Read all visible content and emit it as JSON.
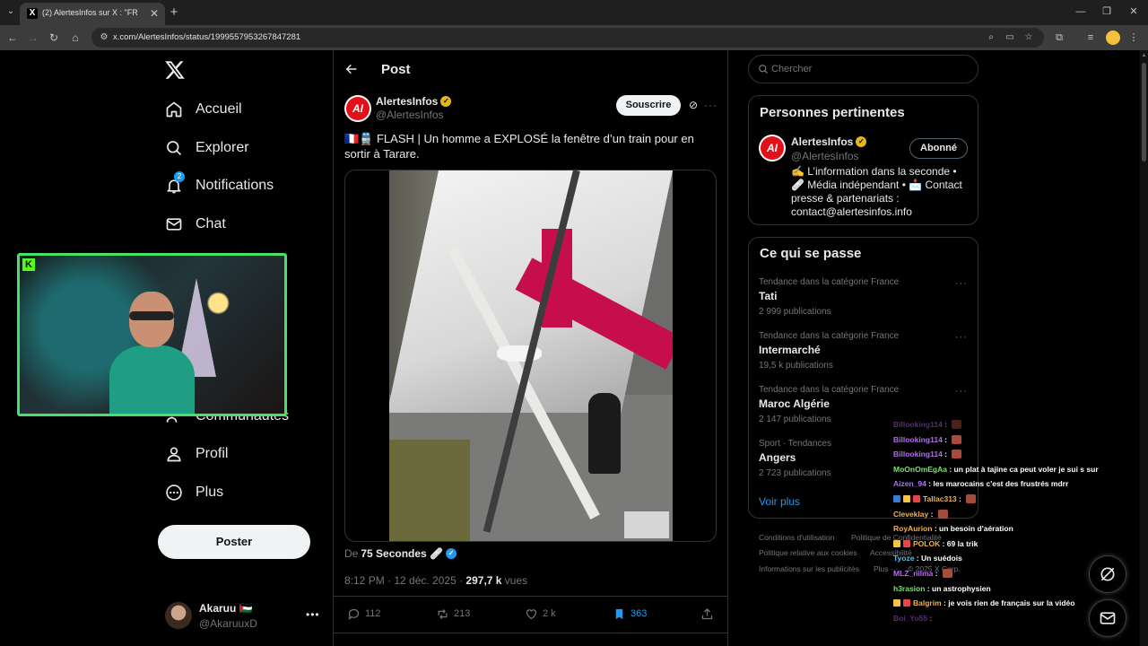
{
  "browser": {
    "tab_title": "(2) AlertesInfos sur X : \"FR",
    "tab_favicon": "X",
    "url": "x.com/AlertesInfos/status/1999557953267847281"
  },
  "nav": {
    "items": [
      {
        "label": "Accueil",
        "icon": "home-icon"
      },
      {
        "label": "Explorer",
        "icon": "search-icon"
      },
      {
        "label": "Notifications",
        "icon": "bell-icon",
        "badge": "2"
      },
      {
        "label": "Chat",
        "icon": "mail-icon"
      },
      {
        "label": "Communautés",
        "icon": "people-icon"
      },
      {
        "label": "Profil",
        "icon": "person-icon"
      },
      {
        "label": "Plus",
        "icon": "more-circle-icon"
      }
    ],
    "post_button": "Poster",
    "user": {
      "name": "Akaruu 🇵🇸",
      "handle": "@AkaruuxD"
    }
  },
  "post": {
    "header_title": "Post",
    "author_name": "AlertesInfos",
    "author_handle": "@AlertesInfos",
    "avatar_text": "AI",
    "subscribe_label": "Souscrire",
    "text": "🇫🇷🚆 FLASH | Un homme a EXPLOSÉ la fenêtre d’un train pour en sortir à Tarare.",
    "from_prefix": "De",
    "from_source": "75 Secondes 🩹",
    "time": "8:12 PM · 12 déc. 2025 · ",
    "views_count": "297,7 k",
    "views_label": " vues",
    "stats": {
      "replies": "112",
      "reposts": "213",
      "likes": "2 k",
      "bookmarks": "363"
    }
  },
  "sidebar": {
    "search_placeholder": "Chercher",
    "relevant": {
      "title": "Personnes pertinentes",
      "name": "AlertesInfos",
      "handle": "@AlertesInfos",
      "follow_label": "Abonné",
      "bio": "✍️ L’information dans la seconde • 🩹 Média indépendant • 📩 Contact presse & partenariats : contact@alertesinfos.info"
    },
    "trends_title": "Ce qui se passe",
    "trends": [
      {
        "category": "Tendance dans la catégorie France",
        "name": "Tati",
        "count": "2 999 publications"
      },
      {
        "category": "Tendance dans la catégorie France",
        "name": "Intermarché",
        "count": "19,5 k publications"
      },
      {
        "category": "Tendance dans la catégorie France",
        "name": "Maroc Algérie",
        "count": "2 147 publications"
      },
      {
        "category": "Sport · Tendances",
        "name": "Angers",
        "count": "2 723 publications"
      }
    ],
    "see_more": "Voir plus",
    "footer": [
      "Conditions d'utilisation",
      "Politique de Confidentialité",
      "Politique relative aux cookies",
      "Accessibilité",
      "Informations sur les publicités",
      "Plus ···",
      "© 2025 X Corp."
    ]
  },
  "chat": [
    {
      "user": "Billooking114",
      "msg": "",
      "color": "#b86bf0",
      "emote": true
    },
    {
      "user": "Billooking114",
      "msg": "",
      "color": "#b86bf0",
      "emote": true
    },
    {
      "user": "Billooking114",
      "msg": "",
      "color": "#b86bf0",
      "emote": true
    },
    {
      "user": "MoOnOmEgAa",
      "msg": "un plat à tajine ca peut voler je sui s sur",
      "color": "#7be36e",
      "emote": false
    },
    {
      "user": "Aizen_94",
      "msg": "les marocains c'est des frustrés mdrr",
      "color": "#b86bf0",
      "emote": false
    },
    {
      "user": "Tallac313",
      "msg": "",
      "color": "#f0b24a",
      "emote": true,
      "badges": [
        "#3a7bd5",
        "#f5c542",
        "#e94545"
      ]
    },
    {
      "user": "Cleveklay",
      "msg": "",
      "color": "#f0b24a",
      "emote": true
    },
    {
      "user": "RoyAurion",
      "msg": "un besoin d'aération",
      "color": "#f0b24a",
      "emote": false
    },
    {
      "user": "POLOK",
      "msg": "69 la trik",
      "color": "#f0b24a",
      "emote": false,
      "badges": [
        "#f5c542",
        "#e94545"
      ]
    },
    {
      "user": "Tyoze",
      "msg": "Un suédois",
      "color": "#5bc0eb",
      "emote": false
    },
    {
      "user": "MLZ_nilma",
      "msg": "",
      "color": "#b86bf0",
      "emote": true
    },
    {
      "user": "h3rasion",
      "msg": "un astrophysien",
      "color": "#7be36e",
      "emote": false
    },
    {
      "user": "Balgrim",
      "msg": "je vois rien de français sur la vidéo",
      "color": "#f0b24a",
      "emote": false,
      "badges": [
        "#f5c542",
        "#e94545"
      ]
    },
    {
      "user": "Boi_Yo55",
      "msg": "",
      "color": "#b86bf0",
      "emote": false
    }
  ],
  "colors": {
    "accent": "#1d9bf0",
    "verified_gold": "#e2b719",
    "webcam_border": "#47e06b"
  }
}
